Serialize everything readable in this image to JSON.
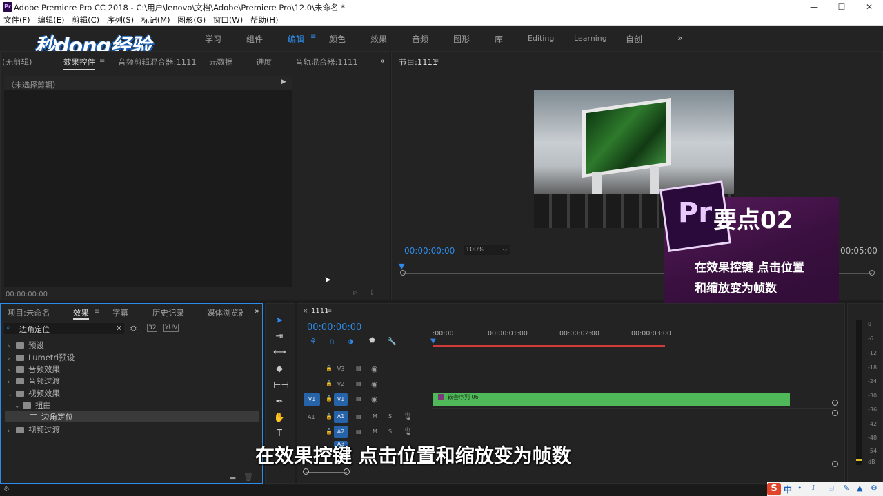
{
  "window": {
    "icon": "Pr",
    "title": "Adobe Premiere Pro CC 2018 - C:\\用户\\lenovo\\文档\\Adobe\\Premiere Pro\\12.0\\未命名 *",
    "minimize": "—",
    "maximize": "☐",
    "close": "✕"
  },
  "menu": [
    "文件(F)",
    "编辑(E)",
    "剪辑(C)",
    "序列(S)",
    "标记(M)",
    "图形(G)",
    "窗口(W)",
    "帮助(H)"
  ],
  "watermark": "秒dong经验",
  "workspaces": [
    "学习",
    "组件",
    "编辑",
    "颜色",
    "效果",
    "音频",
    "图形",
    "库",
    "Editing",
    "Learning",
    "自创"
  ],
  "workspace_active": "编辑",
  "workspace_more": "»",
  "source_panel": {
    "tabs": [
      "(无剪辑)",
      "效果控件",
      "音频剪辑混合器:1111",
      "元数据",
      "进度",
      "音轨混合器:1111"
    ],
    "active_tab": "效果控件",
    "no_clip_label": "（未选择剪辑）",
    "timecode": "00:00:00:00",
    "more": "»"
  },
  "program_monitor": {
    "title": "节目:1111",
    "timecode": "00:00:00:00",
    "zoom": "100%",
    "end_time": "00:05:00"
  },
  "overlay_card": {
    "badge": "Pr",
    "heading": "要点02",
    "line1": "在效果控键 点击位置",
    "line2": "和缩放变为帧数"
  },
  "project_panel": {
    "tabs": [
      "项目:未命名",
      "效果",
      "字幕",
      "历史记录",
      "媒体浏览器"
    ],
    "active_tab": "效果",
    "search_value": "边角定位",
    "tree": [
      {
        "label": "预设",
        "level": 0,
        "expanded": false
      },
      {
        "label": "Lumetri预设",
        "level": 0,
        "expanded": false
      },
      {
        "label": "音频效果",
        "level": 0,
        "expanded": false
      },
      {
        "label": "音频过渡",
        "level": 0,
        "expanded": false
      },
      {
        "label": "视频效果",
        "level": 0,
        "expanded": true
      },
      {
        "label": "扭曲",
        "level": 1,
        "expanded": true
      },
      {
        "label": "边角定位",
        "level": 2,
        "selected": true
      },
      {
        "label": "视频过渡",
        "level": 0,
        "expanded": false
      }
    ],
    "more": "»"
  },
  "timeline": {
    "sequence_name": "1111",
    "timecode": "00:00:00:00",
    "ruler": [
      ":00:00",
      "00:00:01:00",
      "00:00:02:00",
      "00:00:03:00"
    ],
    "tracks": {
      "video": [
        "V3",
        "V2",
        "V1"
      ],
      "audio": [
        "A1",
        "A2",
        "A3"
      ],
      "source_v": "V1",
      "source_a": "A1"
    },
    "clip_label": "嵌套序列 06"
  },
  "audio_meter_scale": [
    "0",
    "-6",
    "-12",
    "-18",
    "-24",
    "-30",
    "-36",
    "-42",
    "-48",
    "-54",
    "dB"
  ],
  "subtitle": "在效果控键 点击位置和缩放变为帧数",
  "taskbar": {
    "ime": "中",
    "ime_icons": [
      "•",
      "♪",
      "⊞",
      "✎",
      "▲",
      "⚙"
    ]
  },
  "colors": {
    "accent": "#2d8ceb",
    "clip": "#4fb858",
    "playhead": "#3a7fdb",
    "card": "#3a0f40"
  }
}
